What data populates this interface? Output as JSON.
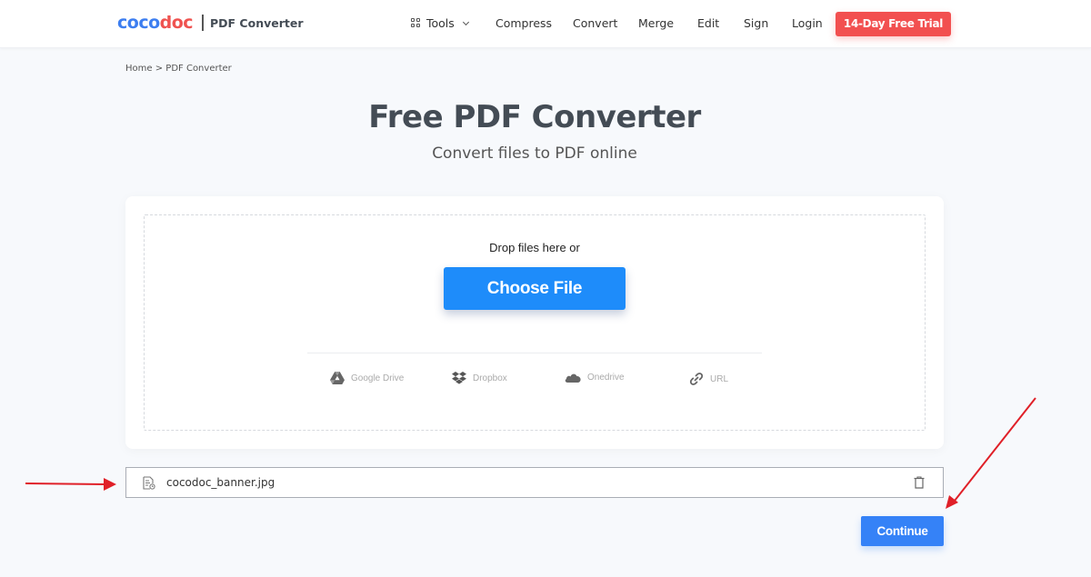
{
  "header": {
    "logo_part1": "coco",
    "logo_part2": "doc",
    "product_name": "PDF Converter",
    "nav": {
      "tools": "Tools",
      "compress": "Compress",
      "convert": "Convert",
      "merge": "Merge",
      "edit": "Edit",
      "sign": "Sign",
      "login": "Login"
    },
    "trial_button": "14-Day Free Trial"
  },
  "breadcrumb": {
    "home": "Home",
    "separator": ">",
    "current": "PDF Converter"
  },
  "hero": {
    "title": "Free PDF Converter",
    "subtitle": "Convert files to PDF online"
  },
  "upload": {
    "drop_text": "Drop files here or",
    "choose_button": "Choose File",
    "sources": [
      {
        "label": "Google Drive",
        "icon": "google-drive-icon"
      },
      {
        "label": "Dropbox",
        "icon": "dropbox-icon"
      },
      {
        "label": "Onedrive",
        "icon": "onedrive-icon"
      },
      {
        "label": "URL",
        "icon": "link-icon"
      }
    ]
  },
  "file_list": [
    {
      "name": "cocodoc_banner.jpg",
      "icon": "file-image-icon",
      "action_icon": "trash-icon"
    }
  ],
  "continue_button": "Continue",
  "colors": {
    "brand_blue": "#3d7ef0",
    "brand_red": "#ef5350",
    "trial_red": "#f25050",
    "choose_blue": "#1e8cfa",
    "continue_blue": "#3582f7",
    "annotation_red": "#e02028"
  }
}
